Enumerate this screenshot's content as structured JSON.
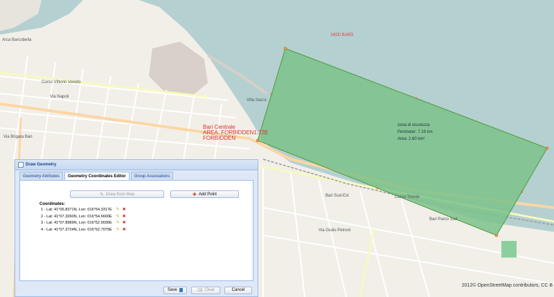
{
  "map": {
    "sea_label": "MOD BARD",
    "place_labels": [
      "Arca Barcobella",
      "Corso Vittorio Veneto",
      "Via Napoli",
      "Via Brigata Bari",
      "Bari Sud-Est",
      "Via Giulio Petroni",
      "Corso Trieste",
      "Bari Parco Sud",
      "Villa Sacra"
    ],
    "forbidden_area_label": [
      "Bari Centrale",
      "AREA: FORBIDDEN1.72E",
      "FORBIDDEN"
    ],
    "zone": {
      "name": "zona di sicurezza",
      "perimeter": "Perimeter: 7.19 km",
      "area": "Area: 2.60 km²",
      "fill_color": "#7cc28a",
      "stroke_color": "#4c9a3a"
    },
    "attribution": "2012© OpenStreetMap contributors, CC B"
  },
  "dialog": {
    "title": "Draw Geometry",
    "tabs": [
      {
        "label": "Geometry Attributes",
        "active": false
      },
      {
        "label": "Geometry Coordinates Editor",
        "active": true
      },
      {
        "label": "Group Associations",
        "active": false
      }
    ],
    "draw_from_map_label": "Draw from Map",
    "add_point_label": "Add Point",
    "coordinates_title": "Coordinates:",
    "coordinates": [
      "1 - Lat: 41°06.8371N, Lon: 016°54.3317E",
      "2 - Lat: 41°07.3260N, Lon: 016°54.6600E",
      "3 - Lat: 41°07.8989N, Lon: 016°52.9036E",
      "4 - Lat: 41°07.3724N, Lon: 016°52.7075E"
    ],
    "save_label": "Save",
    "clear_label": "Clear",
    "cancel_label": "Cancel"
  }
}
